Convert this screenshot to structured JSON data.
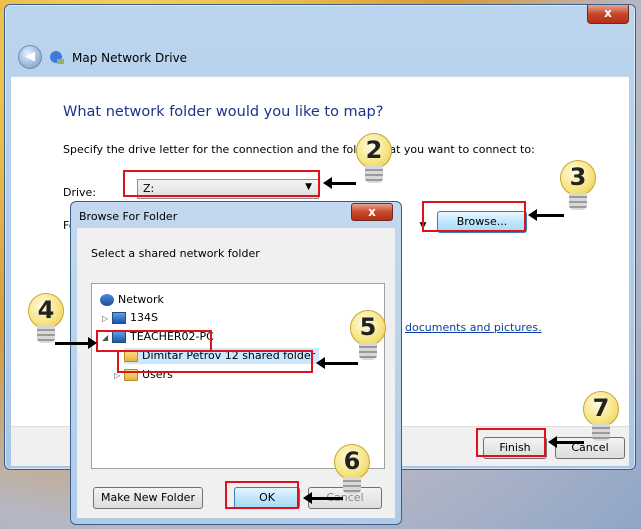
{
  "wizard": {
    "title": "Map Network Drive",
    "close_label": "x",
    "heading": "What network folder would you like to map?",
    "instruction": "Specify the drive letter for the connection and the folder that you want to connect to:",
    "drive_label": "Drive:",
    "drive_value": "Z:",
    "folder_label_fragment": "Fo",
    "browse_label": "Browse...",
    "link_fragment": "documents and pictures.",
    "finish_label": "Finish",
    "cancel_label": "Cancel"
  },
  "browse_dialog": {
    "title": "Browse For Folder",
    "close_label": "x",
    "instruction": "Select a shared network folder",
    "tree": [
      {
        "label": "Network",
        "icon": "network-icon",
        "level": 0
      },
      {
        "label": "134S",
        "icon": "computer-icon",
        "level": 1
      },
      {
        "label": "TEACHER02-PC",
        "icon": "computer-icon",
        "level": 1
      },
      {
        "label": "Dimitar Petrov 12 shared folder",
        "icon": "shared-folder-icon",
        "level": 2
      },
      {
        "label": "Users",
        "icon": "shared-folder-icon",
        "level": 2
      }
    ],
    "new_folder_label": "Make New Folder",
    "ok_label": "OK",
    "cancel_label": "Cancel"
  },
  "callouts": [
    "2",
    "3",
    "4",
    "5",
    "6",
    "7"
  ],
  "colors": {
    "highlight": "#e0111e",
    "heading": "#1e3287"
  }
}
